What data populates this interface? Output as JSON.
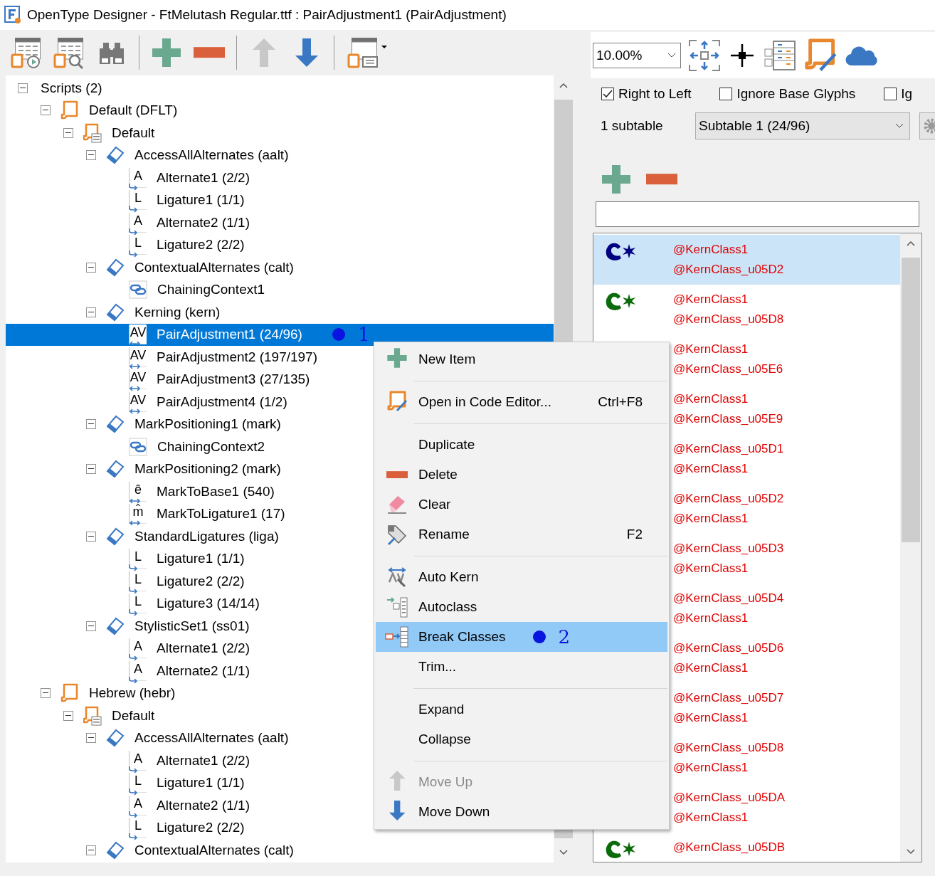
{
  "window": {
    "title": "OpenType Designer - FtMelutash Regular.ttf : PairAdjustment1 (PairAdjustment)"
  },
  "tree": [
    {
      "label": "Scripts (2)",
      "kind": "root",
      "expanded": true,
      "selected": false,
      "children": [
        {
          "label": "Default (DFLT)",
          "kind": "script",
          "expanded": true,
          "selected": false,
          "children": [
            {
              "label": "Default",
              "kind": "language",
              "expanded": true,
              "selected": false,
              "children": [
                {
                  "label": "AccessAllAlternates (aalt)",
                  "kind": "feature",
                  "expanded": true,
                  "selected": false,
                  "children": [
                    {
                      "label": "Alternate1 (2/2)",
                      "kind": "substitution",
                      "icon_text": "A",
                      "selected": false
                    },
                    {
                      "label": "Ligature1 (1/1)",
                      "kind": "substitution",
                      "icon_text": "L",
                      "selected": false
                    },
                    {
                      "label": "Alternate2 (1/1)",
                      "kind": "substitution",
                      "icon_text": "A",
                      "selected": false
                    },
                    {
                      "label": "Ligature2 (2/2)",
                      "kind": "substitution",
                      "icon_text": "L",
                      "selected": false
                    }
                  ]
                },
                {
                  "label": "ContextualAlternates (calt)",
                  "kind": "feature",
                  "expanded": true,
                  "selected": false,
                  "children": [
                    {
                      "label": "ChainingContext1",
                      "kind": "chain",
                      "selected": false
                    }
                  ]
                },
                {
                  "label": "Kerning (kern)",
                  "kind": "feature",
                  "expanded": true,
                  "selected": false,
                  "children": [
                    {
                      "label": "PairAdjustment1 (24/96)",
                      "kind": "positioning",
                      "icon_text": "AV",
                      "selected": true,
                      "annotation": "1"
                    },
                    {
                      "label": "PairAdjustment2 (197/197)",
                      "kind": "positioning",
                      "icon_text": "AV",
                      "selected": false
                    },
                    {
                      "label": "PairAdjustment3 (27/135)",
                      "kind": "positioning",
                      "icon_text": "AV",
                      "selected": false
                    },
                    {
                      "label": "PairAdjustment4 (1/2)",
                      "kind": "positioning",
                      "icon_text": "AV",
                      "selected": false
                    }
                  ]
                },
                {
                  "label": "MarkPositioning1 (mark)",
                  "kind": "feature",
                  "expanded": true,
                  "selected": false,
                  "children": [
                    {
                      "label": "ChainingContext2",
                      "kind": "chain",
                      "selected": false
                    }
                  ]
                },
                {
                  "label": "MarkPositioning2 (mark)",
                  "kind": "feature",
                  "expanded": true,
                  "selected": false,
                  "children": [
                    {
                      "label": "MarkToBase1 (540)",
                      "kind": "positioning",
                      "icon_text": "ê",
                      "selected": false
                    },
                    {
                      "label": "MarkToLigature1 (17)",
                      "kind": "positioning",
                      "icon_text": "m̂",
                      "selected": false
                    }
                  ]
                },
                {
                  "label": "StandardLigatures (liga)",
                  "kind": "feature",
                  "expanded": true,
                  "selected": false,
                  "children": [
                    {
                      "label": "Ligature1 (1/1)",
                      "kind": "substitution",
                      "icon_text": "L",
                      "selected": false
                    },
                    {
                      "label": "Ligature2 (2/2)",
                      "kind": "substitution",
                      "icon_text": "L",
                      "selected": false
                    },
                    {
                      "label": "Ligature3 (14/14)",
                      "kind": "substitution",
                      "icon_text": "L",
                      "selected": false
                    }
                  ]
                },
                {
                  "label": "StylisticSet1 (ss01)",
                  "kind": "feature",
                  "expanded": true,
                  "selected": false,
                  "children": [
                    {
                      "label": "Alternate1 (2/2)",
                      "kind": "substitution",
                      "icon_text": "A",
                      "selected": false
                    },
                    {
                      "label": "Alternate2 (1/1)",
                      "kind": "substitution",
                      "icon_text": "A",
                      "selected": false
                    }
                  ]
                }
              ]
            }
          ]
        },
        {
          "label": "Hebrew (hebr)",
          "kind": "script",
          "expanded": true,
          "selected": false,
          "children": [
            {
              "label": "Default",
              "kind": "language",
              "expanded": true,
              "selected": false,
              "children": [
                {
                  "label": "AccessAllAlternates (aalt)",
                  "kind": "feature",
                  "expanded": true,
                  "selected": false,
                  "children": [
                    {
                      "label": "Alternate1 (2/2)",
                      "kind": "substitution",
                      "icon_text": "A",
                      "selected": false
                    },
                    {
                      "label": "Ligature1 (1/1)",
                      "kind": "substitution",
                      "icon_text": "L",
                      "selected": false
                    },
                    {
                      "label": "Alternate2 (1/1)",
                      "kind": "substitution",
                      "icon_text": "A",
                      "selected": false
                    },
                    {
                      "label": "Ligature2 (2/2)",
                      "kind": "substitution",
                      "icon_text": "L",
                      "selected": false
                    }
                  ]
                },
                {
                  "label": "ContextualAlternates (calt)",
                  "kind": "feature",
                  "expanded": true,
                  "selected": false
                }
              ]
            }
          ]
        }
      ]
    }
  ],
  "zoom": {
    "value": "10.00%"
  },
  "checkboxes": [
    {
      "label": "Right to Left",
      "checked": true
    },
    {
      "label": "Ignore Base Glyphs",
      "checked": false
    },
    {
      "label": "Ig",
      "checked": false
    }
  ],
  "subtables": {
    "count": "1 subtable",
    "value": "Subtable 1 (24/96)"
  },
  "pairs": [
    {
      "first": "@KernClass1",
      "second": "@KernClass_u05D2",
      "color": "#000080",
      "selected": true
    },
    {
      "first": "@KernClass1",
      "second": "@KernClass_u05D8",
      "color": "#0b6b0b",
      "selected": false
    },
    {
      "first": "@KernClass1",
      "second": "@KernClass_u05E6",
      "selected": false
    },
    {
      "first": "@KernClass1",
      "second": "@KernClass_u05E9",
      "selected": false
    },
    {
      "first": "@KernClass_u05D1",
      "second": "@KernClass1",
      "selected": false
    },
    {
      "first": "@KernClass_u05D2",
      "second": "@KernClass1",
      "selected": false
    },
    {
      "first": "@KernClass_u05D3",
      "second": "@KernClass1",
      "selected": false
    },
    {
      "first": "@KernClass_u05D4",
      "second": "@KernClass1",
      "selected": false
    },
    {
      "first": "@KernClass_u05D6",
      "second": "@KernClass1",
      "selected": false
    },
    {
      "first": "@KernClass_u05D7",
      "second": "@KernClass1",
      "selected": false
    },
    {
      "first": "@KernClass_u05D8",
      "second": "@KernClass1",
      "selected": false
    },
    {
      "first": "@KernClass_u05DA",
      "second": "@KernClass1",
      "selected": false
    },
    {
      "first": "@KernClass_u05DB",
      "color": "#0b6b0b",
      "selected": false
    }
  ],
  "context_menu": {
    "groups": [
      {
        "items": [
          {
            "label": "New Item",
            "kind": "add",
            "selected": false,
            "disabled": false
          }
        ]
      },
      {
        "items": [
          {
            "label": "Open in Code Editor...",
            "shortcut": "Ctrl+F8",
            "kind": "code",
            "selected": false,
            "disabled": false
          }
        ]
      },
      {
        "items": [
          {
            "label": "Duplicate",
            "kind": "plain",
            "selected": false,
            "disabled": false
          },
          {
            "label": "Delete",
            "kind": "delete",
            "selected": false,
            "disabled": false
          },
          {
            "label": "Clear",
            "kind": "clear",
            "selected": false,
            "disabled": false
          },
          {
            "label": "Rename",
            "shortcut": "F2",
            "kind": "rename",
            "selected": false,
            "disabled": false
          }
        ]
      },
      {
        "items": [
          {
            "label": "Auto Kern",
            "kind": "autokern",
            "selected": false,
            "disabled": false
          },
          {
            "label": "Autoclass",
            "kind": "autoclass",
            "selected": false,
            "disabled": false
          },
          {
            "label": "Break Classes",
            "kind": "break",
            "selected": true,
            "disabled": false,
            "annotation": "2"
          },
          {
            "label": "Trim...",
            "kind": "plain",
            "selected": false,
            "disabled": false
          }
        ]
      },
      {
        "items": [
          {
            "label": "Expand",
            "kind": "plain",
            "selected": false,
            "disabled": false
          },
          {
            "label": "Collapse",
            "kind": "plain",
            "selected": false,
            "disabled": false
          }
        ]
      },
      {
        "items": [
          {
            "label": "Move Up",
            "kind": "up",
            "selected": false,
            "disabled": true
          },
          {
            "label": "Move Down",
            "kind": "down",
            "selected": false,
            "disabled": false
          }
        ]
      }
    ]
  }
}
